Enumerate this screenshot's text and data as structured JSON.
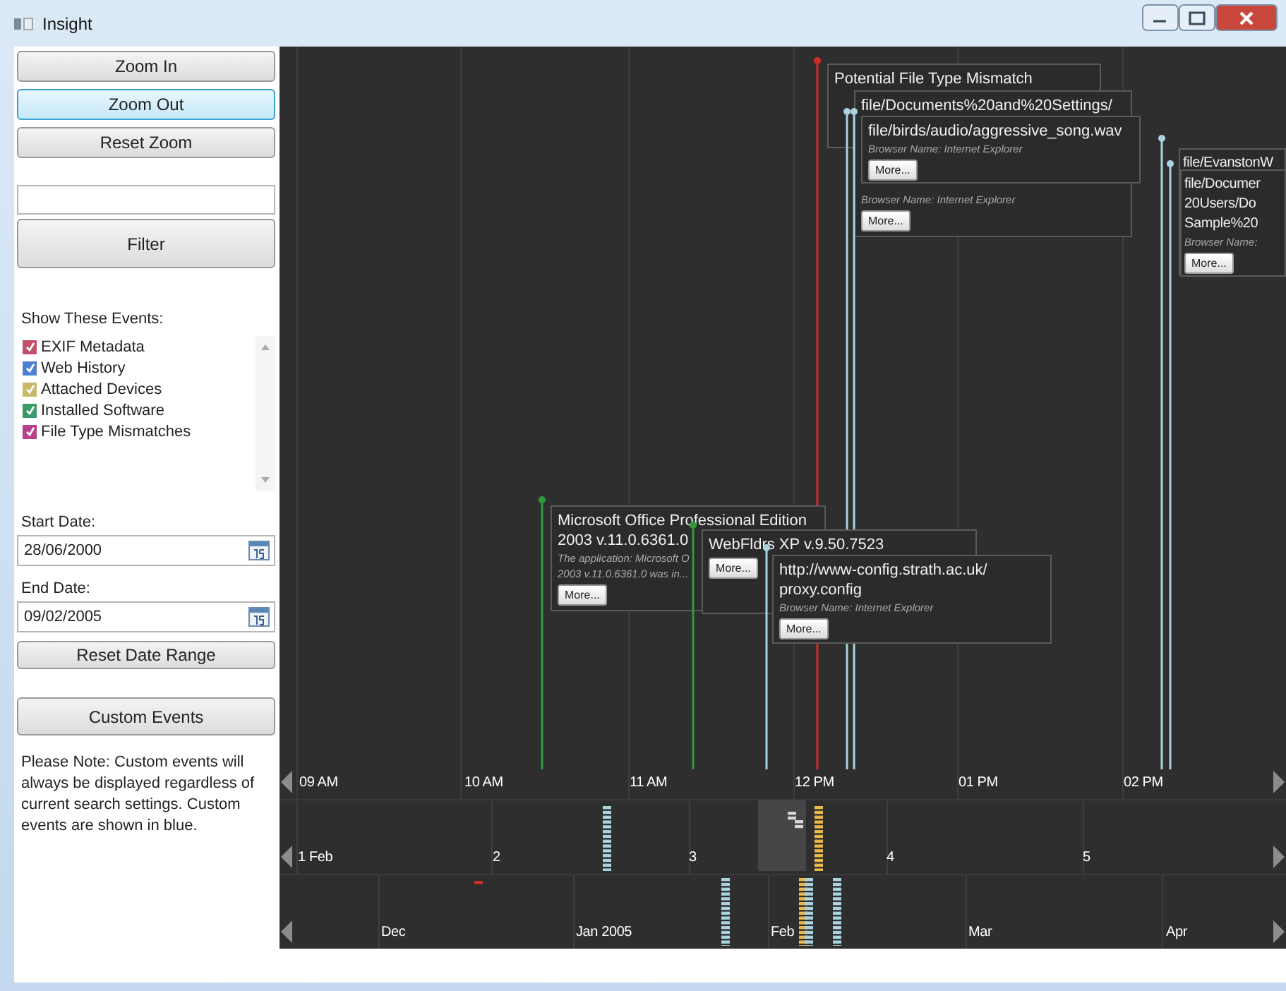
{
  "window": {
    "title": "Insight"
  },
  "sidebar": {
    "zoom_buttons": [
      {
        "label": "Zoom In",
        "focused": false
      },
      {
        "label": "Zoom Out",
        "focused": true
      },
      {
        "label": "Reset Zoom",
        "focused": false
      }
    ],
    "filter_button": "Filter",
    "events_filter": {
      "heading": "Show These Events:",
      "items": [
        {
          "label": "EXIF Metadata",
          "checked": true,
          "color": "#c0506a"
        },
        {
          "label": "Web History",
          "checked": true,
          "color": "#4f7fd0"
        },
        {
          "label": "Attached Devices",
          "checked": true,
          "color": "#c9b86a"
        },
        {
          "label": "Installed Software",
          "checked": true,
          "color": "#3a9a66"
        },
        {
          "label": "File Type Mismatches",
          "checked": true,
          "color": "#b8408a"
        }
      ]
    },
    "start_date": {
      "label": "Start Date:",
      "value": "28/06/2000"
    },
    "end_date": {
      "label": "End Date:",
      "value": "09/02/2005"
    },
    "reset_date_button": "Reset Date Range",
    "custom_events_button": "Custom Events",
    "note": "Please Note: Custom events will always be displayed regardless of current search settings. Custom events are shown in blue."
  },
  "timeline": {
    "events": [
      {
        "title": [
          "Potential File Type Mismatch"
        ],
        "color": "#d42a2a"
      },
      {
        "title": [
          "file/Documents%20and%20Settings/"
        ],
        "description": [
          "Browser Name: Internet Explorer"
        ],
        "button": "More...",
        "color": "#a9d3df"
      },
      {
        "title": [
          "file/birds/audio/aggressive_song.wav"
        ],
        "description": [
          "Browser Name: Internet Explorer"
        ],
        "button": "More...",
        "color": "#a9d3df"
      },
      {
        "title": [
          "file/EvanstonW"
        ],
        "color": "#a9d3df"
      },
      {
        "title": [
          "file/Documer",
          "20Users/Do",
          "Sample%20"
        ],
        "description": [
          "Browser Name:"
        ],
        "button": "More...",
        "color": "#a9d3df"
      },
      {
        "title": [
          "Microsoft Office Professional Edition",
          "2003 v.11.0.6361.0"
        ],
        "description": [
          "The application: Microsoft O",
          "2003 v.11.0.6361.0 was in..."
        ],
        "button": "More...",
        "color": "#2e9a3a"
      },
      {
        "title": [
          "WebFldrs XP v.9.50.7523"
        ],
        "button": "More...",
        "color": "#2e9a3a"
      },
      {
        "title": [
          "http://www-config.strath.ac.uk/",
          "proxy.config"
        ],
        "description": [
          "Browser Name: Internet Explorer"
        ],
        "button": "More...",
        "color": "#a9d3df"
      }
    ],
    "bands": [
      {
        "labels": [
          "09 AM",
          "10 AM",
          "11 AM",
          "12 PM",
          "01 PM",
          "02 PM"
        ]
      },
      {
        "labels": [
          "1 Feb",
          "2",
          "3",
          "4",
          "5"
        ]
      },
      {
        "labels": [
          "Dec",
          "Jan 2005",
          "Feb",
          "Mar",
          "Apr"
        ]
      }
    ]
  }
}
